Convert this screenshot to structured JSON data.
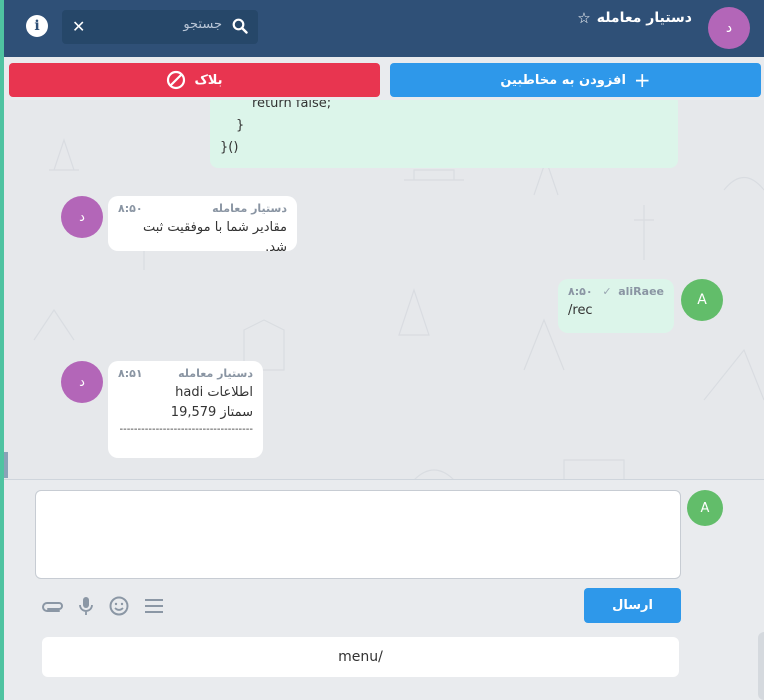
{
  "header": {
    "avatar_letter": "د",
    "title": "دستیار معامله",
    "star": "☆",
    "info": "i",
    "search_placeholder": "جستجو",
    "search_close": "✕"
  },
  "actions": {
    "add_contacts_label": "افزودن به مخاطبین",
    "block_label": "بلاک",
    "block_color": "#e83550",
    "add_color": "#2e98ea"
  },
  "messages": {
    "code_lines": [
      "return false;",
      "}",
      "}()"
    ],
    "m1": {
      "sender": "دستیار معامله",
      "time": "۸:۵۰",
      "avatar": "د",
      "lines": [
        "مقادیر شما با موفقیت ثبت شد."
      ]
    },
    "m2": {
      "sender": "aliRaee",
      "time": "۸:۵۰",
      "avatar": "A",
      "lines": [
        "/rec"
      ]
    },
    "m3": {
      "sender": "دستیار معامله",
      "time": "۸:۵۱",
      "avatar": "د",
      "lines": [
        "اطلاعات hadi",
        "سمتاز 19,579",
        "-------------------------------------"
      ]
    }
  },
  "composer": {
    "avatar": "A",
    "placeholder": "",
    "send_label": "ارسال",
    "quick_reply": "menu/"
  },
  "colors": {
    "header_bg": "#2f5077",
    "avatar_purple": "#b366b8",
    "avatar_green": "#62bd6a",
    "outgoing_bubble": "#dcf5ea"
  }
}
